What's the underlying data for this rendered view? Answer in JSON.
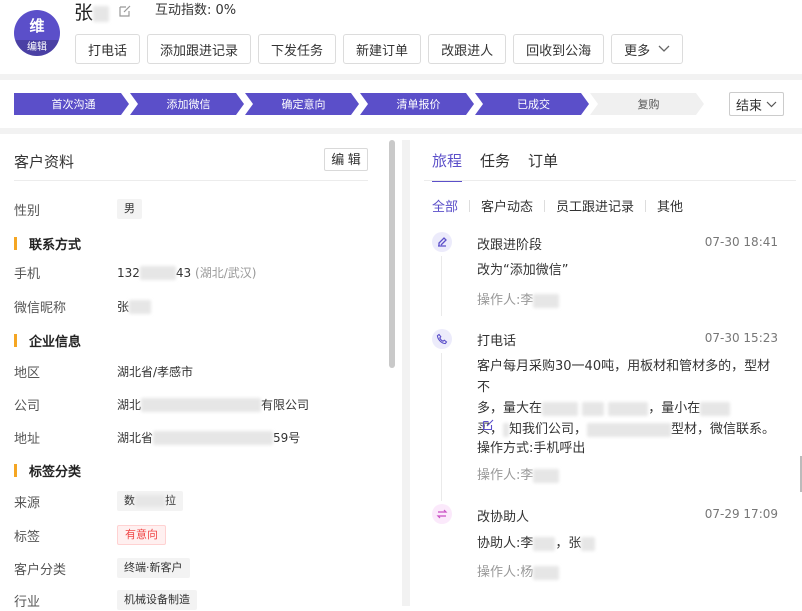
{
  "customer": {
    "avatar_text": "维",
    "avatar_edit": "编辑",
    "name": "张",
    "interaction_label": "互动指数:",
    "interaction_value": "0%"
  },
  "actions": [
    "打电话",
    "添加跟进记录",
    "下发任务",
    "新建订单",
    "改跟进人",
    "回收到公海",
    "更多"
  ],
  "stages": {
    "items": [
      "首次沟通",
      "添加微信",
      "确定意向",
      "清单报价",
      "已成交",
      "复购"
    ],
    "done_count": 5,
    "end_select": "结束",
    "colors": {
      "active": "#5b4fc9",
      "inactive": "#f0f0f0"
    }
  },
  "profile": {
    "title": "客户资料",
    "edit_label": "编 辑",
    "gender_label": "性别",
    "gender_value": "男",
    "contact_section": "联系方式",
    "phone_label": "手机",
    "phone_prefix": "132",
    "phone_suffix": "43",
    "phone_region": "(湖北/武汉)",
    "wechat_label": "微信昵称",
    "wechat_value": "张",
    "company_section": "企业信息",
    "region_label": "地区",
    "region_value": "湖北省/孝感市",
    "company_label": "公司",
    "company_prefix": "湖北",
    "company_suffix": "有限公司",
    "address_label": "地址",
    "address_prefix": "湖北省",
    "address_suffix": "59号",
    "tag_section": "标签分类",
    "source_label": "来源",
    "source_value": "数",
    "source_tail": "拉",
    "tag_label": "标签",
    "tag_value": "有意向",
    "category_label": "客户分类",
    "category_value": "终端·新客户",
    "industry_label": "行业",
    "industry_value": "机械设备制造"
  },
  "journey": {
    "tabs": [
      "旅程",
      "任务",
      "订单"
    ],
    "subtabs": [
      "全部",
      "客户动态",
      "员工跟进记录",
      "其他"
    ],
    "events": [
      {
        "icon": "stage-icon",
        "title": "改跟进阶段",
        "time": "07-30 18:41",
        "text": "改为“添加微信”",
        "operator": "操作人:李"
      },
      {
        "icon": "phone-icon",
        "title": "打电话",
        "time": "07-30 15:23",
        "text_1": "客户每月采购30一40吨，用板材和管材多的，型材不",
        "text_2a": "多，量大在",
        "text_2b": "，量小在",
        "text_3a": "买，",
        "text_3b": "知我们公司，",
        "text_3c": "型材，微信联系。",
        "method": "操作方式:手机呼出",
        "operator": "操作人:李"
      },
      {
        "icon": "swap-icon",
        "title": "改协助人",
        "time": "07-29 17:09",
        "text_a": "协助人:李",
        "text_b": "，张",
        "operator": "操作人:杨"
      }
    ]
  }
}
